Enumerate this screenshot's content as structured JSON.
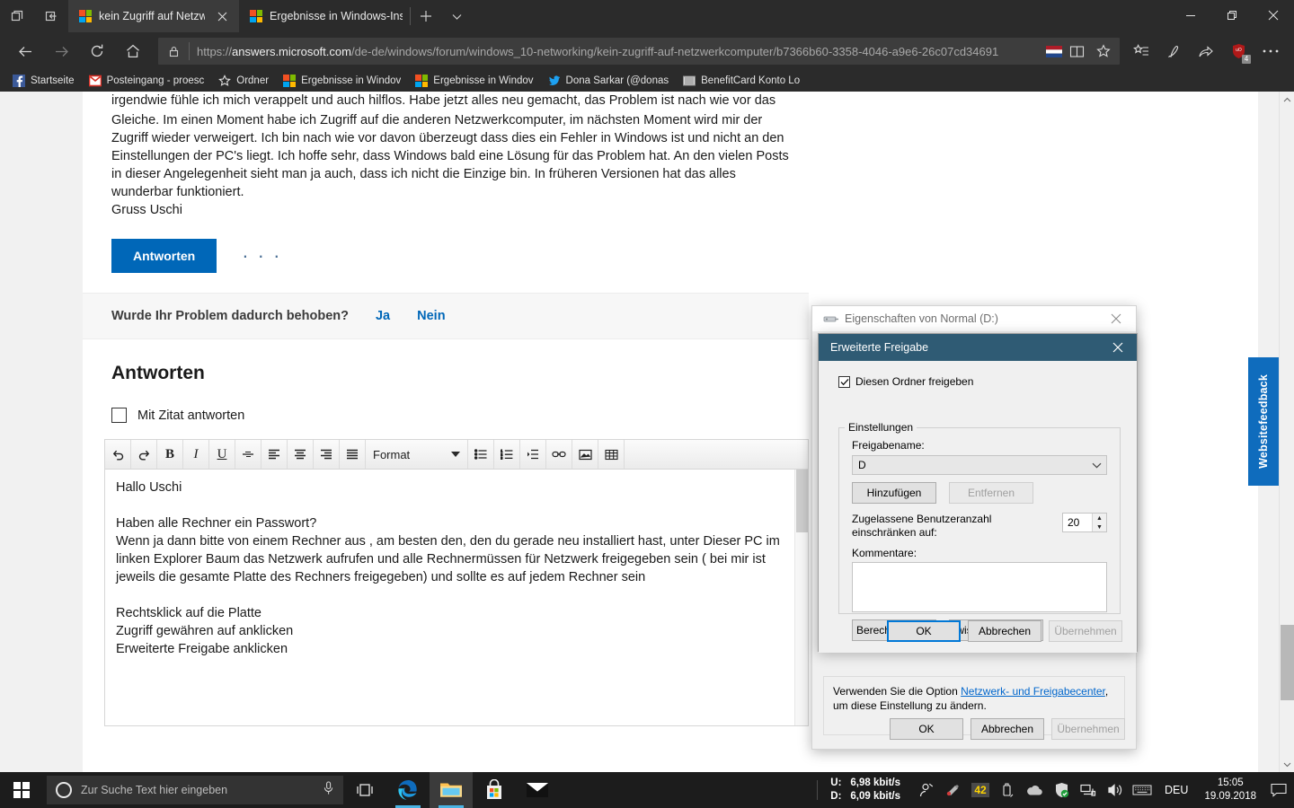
{
  "browser": {
    "tabs": [
      {
        "title": "kein Zugriff auf Netzwer",
        "active": true
      },
      {
        "title": "Ergebnisse in Windows-Insi",
        "active": false
      }
    ],
    "url_scheme": "https://",
    "url_domain": "answers.microsoft.com",
    "url_path": "/de-de/windows/forum/windows_10-networking/kein-zugriff-auf-netzwerkcomputer/b7366b60-3358-4046-a9e6-26c07cd34691",
    "ublock_count": "4",
    "bookmarks": [
      {
        "label": "Startseite",
        "icon": "facebook-icon"
      },
      {
        "label": "Posteingang - proesc",
        "icon": "gmail-icon"
      },
      {
        "label": "Ordner",
        "icon": "star-icon"
      },
      {
        "label": "Ergebnisse in Windov",
        "icon": "microsoft-icon"
      },
      {
        "label": "Ergebnisse in Windov",
        "icon": "microsoft-icon"
      },
      {
        "label": "Dona Sarkar (@donas",
        "icon": "twitter-icon"
      },
      {
        "label": "BenefitCard Konto Lo",
        "icon": "site-icon"
      }
    ]
  },
  "page": {
    "post_text_clipped": "irgendwie fühle ich mich verappelt und auch hilflos. Habe jetzt alles neu gemacht, das Problem ist nach wie vor das",
    "post_paragraphs": [
      "Gleiche. Im einen Moment habe ich Zugriff auf die anderen Netzwerkcomputer, im nächsten Moment wird mir der",
      "Zugriff wieder verweigert. Ich bin nach wie vor davon überzeugt dass dies ein Fehler in Windows ist und nicht an den",
      "Einstellungen der PC's liegt. Ich hoffe sehr, dass Windows bald eine Lösung für das Problem hat. An den vielen Posts",
      "in dieser Angelegenheit sieht man ja auch, dass ich nicht die Einzige bin. In früheren Versionen hat das alles",
      "wunderbar funktioniert.",
      "Gruss Uschi"
    ],
    "reply_button": "Antworten",
    "more_actions": "· · ·",
    "resolved_question": "Wurde Ihr Problem dadurch behoben?",
    "resolved_yes": "Ja",
    "resolved_no": "Nein",
    "answers_heading": "Antworten",
    "quote_checkbox_label": "Mit Zitat antworten",
    "feedback_tab": "Websitefeedback"
  },
  "editor": {
    "format_label": "Format",
    "toolbar_buttons": [
      "undo-icon",
      "redo-icon",
      "bold-icon",
      "italic-icon",
      "underline-icon",
      "strikethrough-icon",
      "align-left-icon",
      "align-center-icon",
      "align-right-icon",
      "align-justify-icon"
    ],
    "toolbar_buttons_right": [
      "bullet-list-icon",
      "numbered-list-icon",
      "indent-icon",
      "link-icon",
      "image-icon",
      "table-icon"
    ],
    "lines": [
      "Hallo Uschi",
      "",
      "Haben alle Rechner ein Passwort?",
      "Wenn  ja dann bitte von einem Rechner aus , am besten den, den du gerade neu installiert hast, unter Dieser PC im",
      "linken Explorer Baum  das Netzwerk aufrufen und alle Rechnermüssen für Netzwerk freigegeben sein ( bei mir ist",
      "jeweils die gesamte Platte des Rechners freigegeben) und sollte es auf jedem Rechner sein",
      "",
      "Rechtsklick auf die Platte",
      "Zugriff gewähren auf anklicken",
      "Erweiterte Freigabe anklicken"
    ]
  },
  "properties_dialog": {
    "title": "Eigenschaften von Normal (D:)",
    "note_prefix": "Verwenden Sie die Option ",
    "note_link": "Netzwerk- und Freigabecenter",
    "note_suffix": ", um diese Einstellung zu ändern.",
    "ok": "OK",
    "cancel": "Abbrechen",
    "apply": "Übernehmen"
  },
  "share_dialog": {
    "title": "Erweiterte Freigabe",
    "share_checkbox_label": "Diesen Ordner freigeben",
    "group_legend": "Einstellungen",
    "share_name_label": "Freigabename:",
    "share_name_value": "D",
    "add_button": "Hinzufügen",
    "remove_button": "Entfernen",
    "limit_label": "Zugelassene Benutzeranzahl einschränken auf:",
    "limit_value": "20",
    "comments_label": "Kommentare:",
    "comments_value": "",
    "permissions_button": "Berechtigungen",
    "caching_button": "Zwischenspeichern",
    "ok": "OK",
    "cancel": "Abbrechen",
    "apply": "Übernehmen"
  },
  "taskbar": {
    "search_placeholder": "Zur Suche Text hier eingeben",
    "apps": [
      {
        "name": "task-view-icon"
      },
      {
        "name": "edge-icon"
      },
      {
        "name": "file-explorer-icon"
      },
      {
        "name": "microsoft-store-icon"
      },
      {
        "name": "mail-icon"
      }
    ],
    "net_up_label": "U:",
    "net_down_label": "D:",
    "net_up_value": "6,98 kbit/s",
    "net_down_value": "6,09 kbit/s",
    "cpu_badge": "42",
    "language": "DEU",
    "clock_time": "15:05",
    "clock_date": "19.09.2018"
  },
  "colors": {
    "accent_blue": "#0067b8",
    "dialog_title_bg": "#2f5b74",
    "taskbar_bg": "#1c1c1c",
    "chrome_bg": "#2b2b2b",
    "feedback_blue": "#0f6cbd"
  }
}
